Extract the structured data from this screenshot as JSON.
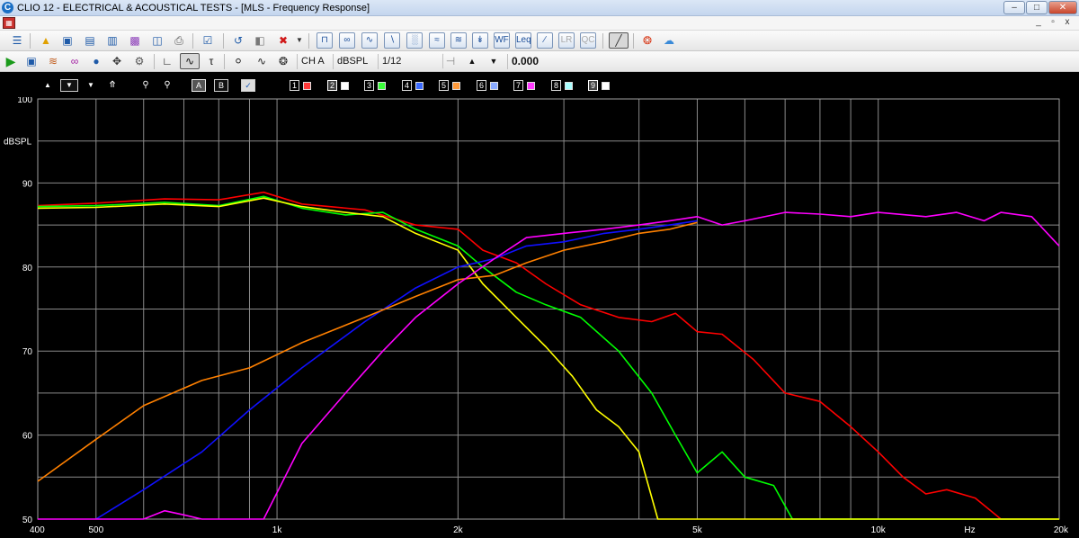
{
  "window": {
    "logo_letter": "C",
    "title": "CLIO 12 - ELECTRICAL & ACOUSTICAL TESTS - [MLS - Frequency Response]",
    "minimize": "–",
    "maximize": "□",
    "close": "✕"
  },
  "mdi": {
    "minimize": "_",
    "restore": "▫",
    "close": "x"
  },
  "toolbar1": {
    "icons": [
      "menu-icon",
      "open-icon",
      "save-icon",
      "save-as-icon",
      "export-icon",
      "image-icon",
      "print-icon",
      "check-icon",
      "undo-icon",
      "eraser-icon",
      "delete-icon",
      "dropdown-icon",
      "mls-icon",
      "sinusoid-icon",
      "multimeter-icon",
      "signal-icon",
      "fft-icon",
      "waterfall-icon",
      "acoustic-icon",
      "impedance-icon",
      "wf-icon",
      "leq-icon",
      "slope-icon",
      "lr-icon",
      "qc-icon",
      "ruler-icon",
      "help-icon",
      "cloud-icon"
    ],
    "lr_label": "LR",
    "qc_label": "QC",
    "wf_label": "WF",
    "leq_label": "Leq"
  },
  "toolbar2": {
    "channel": "CH A",
    "units": "dBSPL",
    "smoothing": "1/12 Octave",
    "value": "0.000"
  },
  "plot_toolbar": {
    "overlay_a": "A",
    "overlay_b": "B",
    "check": "✓",
    "channels": [
      {
        "num": "1",
        "color": "#ff3a3a"
      },
      {
        "num": "2",
        "color": "#ffffff"
      },
      {
        "num": "3",
        "color": "#3aff3a"
      },
      {
        "num": "4",
        "color": "#3a6aff"
      },
      {
        "num": "5",
        "color": "#ff9a3a"
      },
      {
        "num": "6",
        "color": "#8aaaff"
      },
      {
        "num": "7",
        "color": "#ff3aff"
      },
      {
        "num": "8",
        "color": "#aaffff"
      },
      {
        "num": "9",
        "color": "#ffffff"
      }
    ]
  },
  "chart_data": {
    "type": "line",
    "ylabel": "dBSPL",
    "xlabel_unit": "Hz",
    "xscale": "log",
    "xlim": [
      400,
      20000
    ],
    "ylim": [
      50,
      100
    ],
    "y_ticks": [
      50,
      60,
      70,
      80,
      90,
      100
    ],
    "x_tick_labels": [
      {
        "value": 400,
        "label": "400"
      },
      {
        "value": 500,
        "label": "500"
      },
      {
        "value": 1000,
        "label": "1k"
      },
      {
        "value": 2000,
        "label": "2k"
      },
      {
        "value": 5000,
        "label": "5k"
      },
      {
        "value": 10000,
        "label": "10k"
      },
      {
        "value": 20000,
        "label": "20k"
      }
    ],
    "grid": true,
    "background": "#000000",
    "series": [
      {
        "color": "#ff0000",
        "points": [
          [
            400,
            87.3
          ],
          [
            500,
            87.6
          ],
          [
            650,
            88.1
          ],
          [
            800,
            88.0
          ],
          [
            950,
            88.9
          ],
          [
            1100,
            87.5
          ],
          [
            1400,
            86.8
          ],
          [
            1700,
            85.0
          ],
          [
            2000,
            84.5
          ],
          [
            2200,
            82.0
          ],
          [
            2500,
            80.5
          ],
          [
            2800,
            78.0
          ],
          [
            3200,
            75.5
          ],
          [
            3700,
            74.0
          ],
          [
            4200,
            73.5
          ],
          [
            4600,
            74.5
          ],
          [
            5000,
            72.3
          ],
          [
            5500,
            72.0
          ],
          [
            6200,
            69.0
          ],
          [
            7000,
            65.0
          ],
          [
            8000,
            64.0
          ],
          [
            9000,
            61.0
          ],
          [
            10000,
            58.0
          ],
          [
            11000,
            55.0
          ],
          [
            12000,
            53.0
          ],
          [
            13000,
            53.5
          ],
          [
            14500,
            52.5
          ],
          [
            16000,
            50.0
          ],
          [
            20000,
            50.0
          ]
        ]
      },
      {
        "color": "#00ff00",
        "points": [
          [
            400,
            87.2
          ],
          [
            500,
            87.3
          ],
          [
            650,
            87.7
          ],
          [
            800,
            87.3
          ],
          [
            950,
            88.4
          ],
          [
            1100,
            87.0
          ],
          [
            1300,
            86.2
          ],
          [
            1500,
            86.5
          ],
          [
            1700,
            84.5
          ],
          [
            2000,
            82.5
          ],
          [
            2200,
            80.0
          ],
          [
            2500,
            77.0
          ],
          [
            2800,
            75.5
          ],
          [
            3200,
            74.0
          ],
          [
            3700,
            70.0
          ],
          [
            4200,
            65.0
          ],
          [
            4600,
            60.0
          ],
          [
            5000,
            55.5
          ],
          [
            5500,
            58.0
          ],
          [
            6000,
            55.0
          ],
          [
            6700,
            54.0
          ],
          [
            7200,
            50.0
          ],
          [
            20000,
            50.0
          ]
        ]
      },
      {
        "color": "#ffff00",
        "points": [
          [
            400,
            87.0
          ],
          [
            500,
            87.1
          ],
          [
            650,
            87.5
          ],
          [
            800,
            87.2
          ],
          [
            950,
            88.2
          ],
          [
            1100,
            87.2
          ],
          [
            1300,
            86.5
          ],
          [
            1500,
            86.0
          ],
          [
            1700,
            84.0
          ],
          [
            2000,
            82.0
          ],
          [
            2200,
            78.0
          ],
          [
            2500,
            74.0
          ],
          [
            2800,
            70.5
          ],
          [
            3100,
            67.0
          ],
          [
            3400,
            63.0
          ],
          [
            3700,
            61.0
          ],
          [
            4000,
            58.0
          ],
          [
            4300,
            50.0
          ],
          [
            20000,
            50.0
          ]
        ]
      },
      {
        "color": "#1010ff",
        "points": [
          [
            500,
            50.0
          ],
          [
            600,
            53.5
          ],
          [
            750,
            58.0
          ],
          [
            900,
            63.0
          ],
          [
            1100,
            68.0
          ],
          [
            1400,
            73.5
          ],
          [
            1700,
            77.5
          ],
          [
            2000,
            80.0
          ],
          [
            2300,
            81.0
          ],
          [
            2600,
            82.5
          ],
          [
            3000,
            83.0
          ],
          [
            3500,
            84.0
          ],
          [
            4000,
            84.5
          ],
          [
            4500,
            85.0
          ],
          [
            5000,
            85.5
          ]
        ]
      },
      {
        "color": "#ff8000",
        "points": [
          [
            400,
            54.5
          ],
          [
            500,
            59.5
          ],
          [
            600,
            63.5
          ],
          [
            750,
            66.5
          ],
          [
            900,
            68.0
          ],
          [
            1100,
            71.0
          ],
          [
            1400,
            74.0
          ],
          [
            1700,
            76.5
          ],
          [
            2000,
            78.5
          ],
          [
            2300,
            79.0
          ],
          [
            2600,
            80.5
          ],
          [
            3000,
            82.0
          ],
          [
            3500,
            83.0
          ],
          [
            4000,
            84.0
          ],
          [
            4500,
            84.5
          ],
          [
            5000,
            85.3
          ]
        ]
      },
      {
        "color": "#ff00ff",
        "points": [
          [
            400,
            50.0
          ],
          [
            600,
            50.0
          ],
          [
            650,
            51.0
          ],
          [
            700,
            50.5
          ],
          [
            750,
            50.0
          ],
          [
            950,
            50.0
          ],
          [
            1100,
            59.0
          ],
          [
            1300,
            65.0
          ],
          [
            1500,
            70.0
          ],
          [
            1700,
            74.0
          ],
          [
            2000,
            78.0
          ],
          [
            2300,
            81.0
          ],
          [
            2600,
            83.5
          ],
          [
            3000,
            84.0
          ],
          [
            3500,
            84.5
          ],
          [
            4000,
            85.0
          ],
          [
            4500,
            85.5
          ],
          [
            5000,
            86.0
          ],
          [
            5500,
            85.0
          ],
          [
            6000,
            85.5
          ],
          [
            7000,
            86.5
          ],
          [
            8000,
            86.3
          ],
          [
            9000,
            86.0
          ],
          [
            10000,
            86.5
          ],
          [
            12000,
            86.0
          ],
          [
            13500,
            86.5
          ],
          [
            15000,
            85.5
          ],
          [
            16000,
            86.5
          ],
          [
            18000,
            86.0
          ],
          [
            20000,
            82.5
          ]
        ]
      }
    ]
  }
}
